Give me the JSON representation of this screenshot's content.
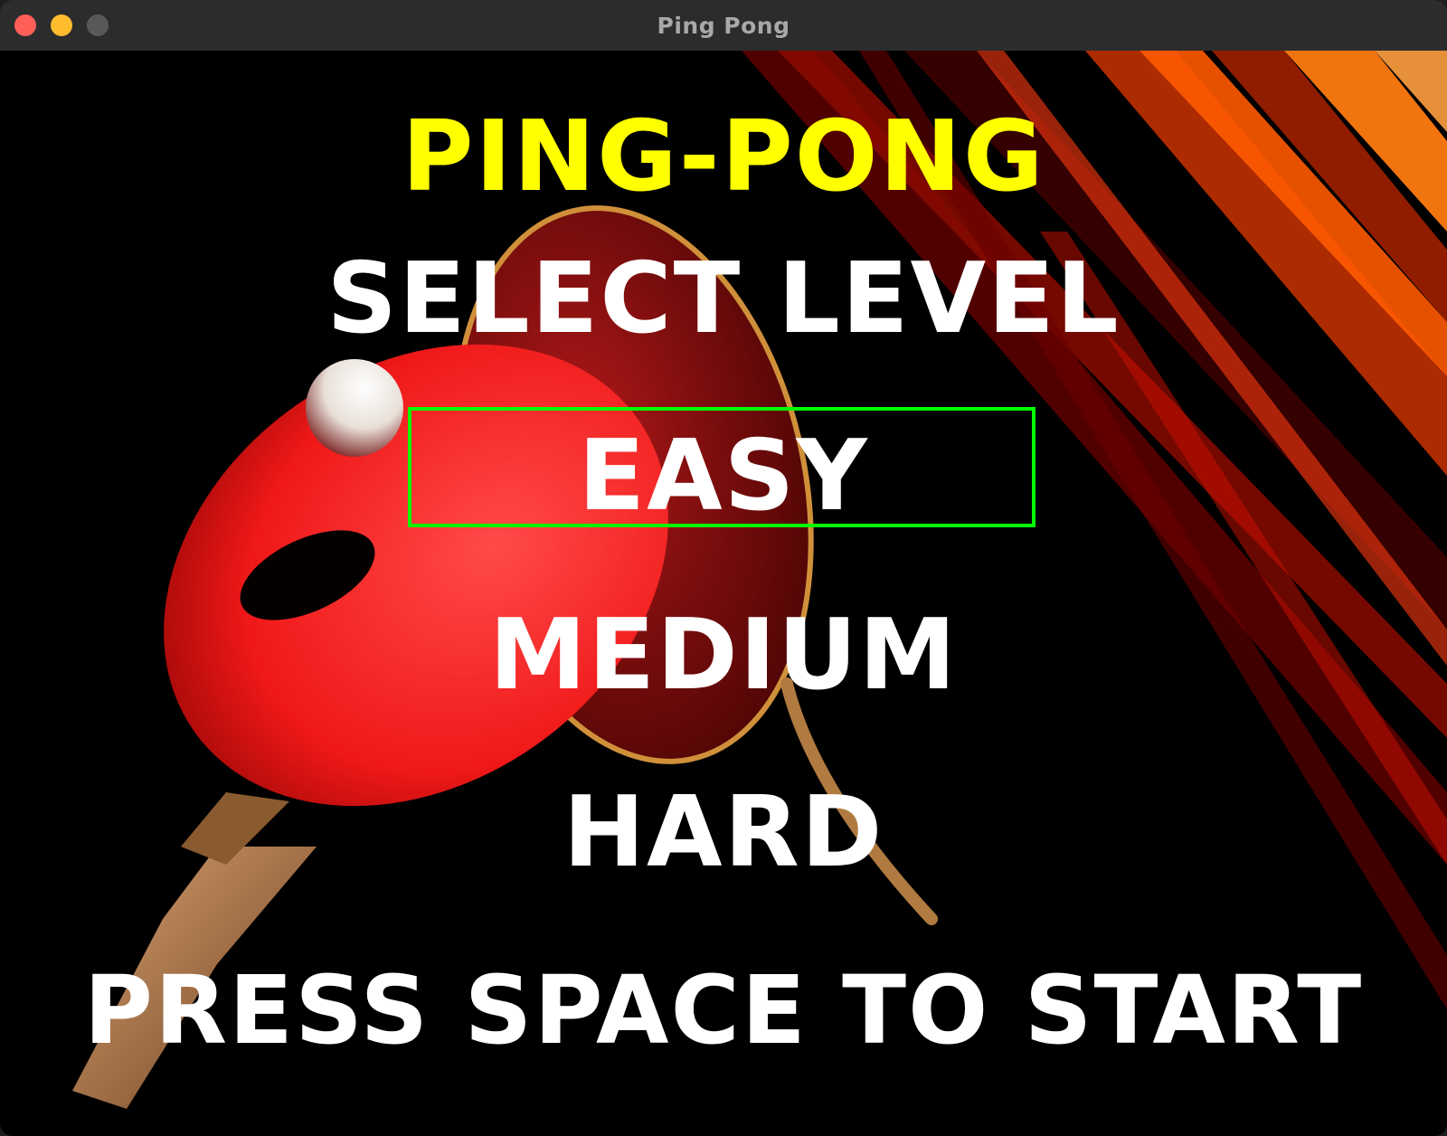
{
  "window": {
    "title": "Ping Pong"
  },
  "game": {
    "title": "PING-PONG",
    "subtitle": "SELECT LEVEL",
    "levels": [
      "EASY",
      "MEDIUM",
      "HARD"
    ],
    "selected_level": "EASY",
    "prompt": "PRESS SPACE TO START"
  },
  "colors": {
    "title": "#ffff00",
    "text": "#ffffff",
    "selection": "#00ff00",
    "paddle_red": "#ff2a2a",
    "background": "#000000"
  }
}
